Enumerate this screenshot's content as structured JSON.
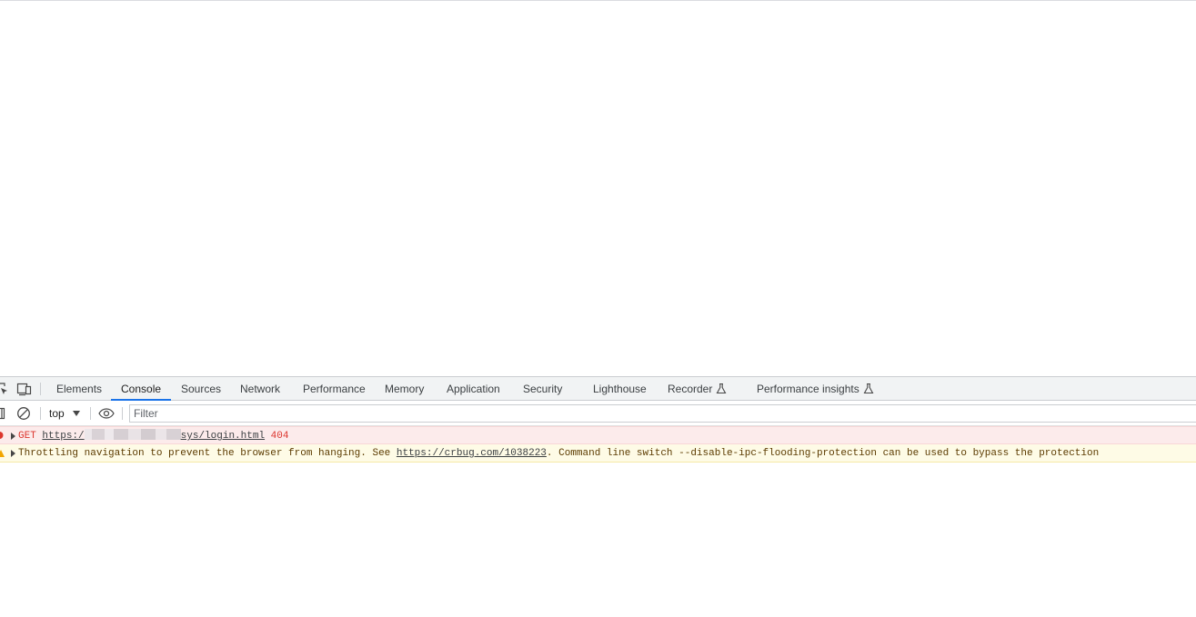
{
  "devtools": {
    "tabs": [
      {
        "label": "Elements"
      },
      {
        "label": "Console"
      },
      {
        "label": "Sources"
      },
      {
        "label": "Network"
      },
      {
        "label": "Performance"
      },
      {
        "label": "Memory"
      },
      {
        "label": "Application"
      },
      {
        "label": "Security"
      },
      {
        "label": "Lighthouse"
      },
      {
        "label": "Recorder"
      },
      {
        "label": "Performance insights"
      }
    ],
    "active_tab": "Console",
    "toolbar": {
      "context": "top",
      "filter_placeholder": "Filter",
      "filter_value": ""
    },
    "messages": [
      {
        "level": "error",
        "method": "GET",
        "url_prefix": "https:/",
        "url_suffix": "sys/login.html",
        "status": "404"
      },
      {
        "level": "warning",
        "text_before": "Throttling navigation to prevent the browser from hanging. See ",
        "link": "https://crbug.com/1038223",
        "text_after": ". Command line switch --disable-ipc-flooding-protection can be used to bypass the protection"
      }
    ],
    "colors": {
      "accent": "#1a73e8",
      "error_bg": "#fcebeb",
      "error_text": "#dc362e",
      "warning_bg": "#fefbe6",
      "warning_text": "#5c3b00"
    }
  }
}
